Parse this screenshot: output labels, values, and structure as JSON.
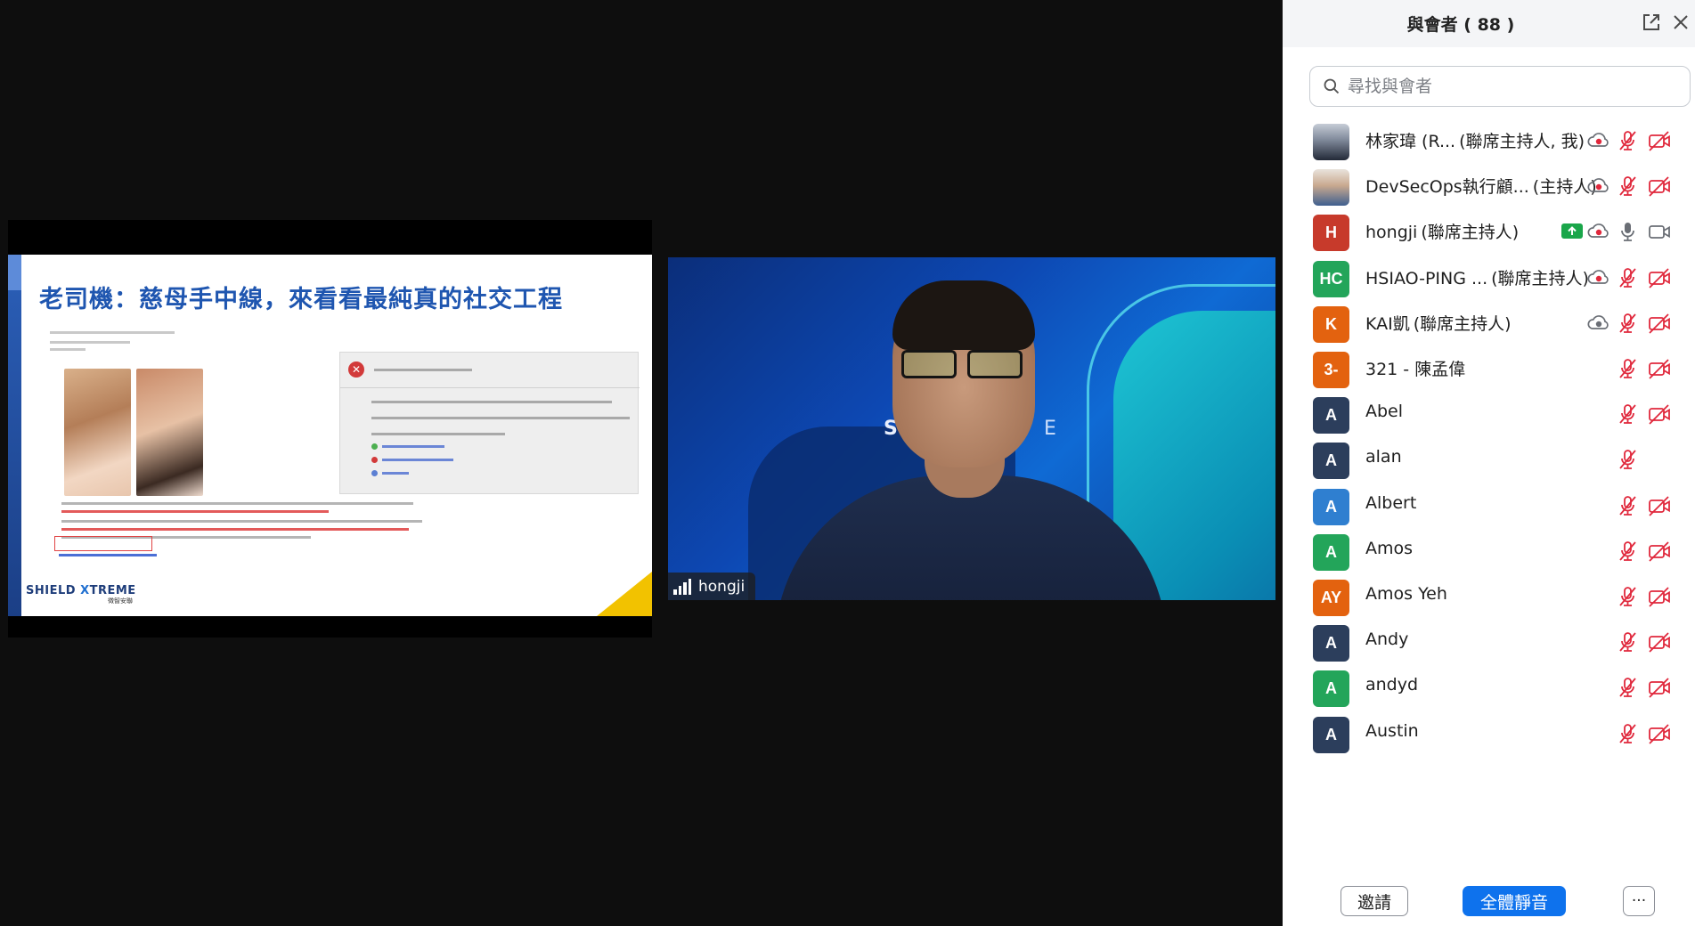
{
  "shared_screen": {
    "slide_title": "老司機：慈母手中線，來看看最純真的社交工程",
    "logo_text": "SHIELD",
    "logo_x": "X",
    "logo_suffix": "TREME",
    "logo_subtitle": "徵智安聯"
  },
  "video": {
    "participant_name": "hongji",
    "background_brand": "S",
    "background_brand_tail": "E"
  },
  "panel": {
    "title": "與會者 ( 88 )",
    "search_placeholder": "尋找與會者",
    "participants": [
      {
        "initials": "",
        "avatar_color": "#56606e",
        "name": "林家瑋 (R...",
        "role": "(聯席主持人, 我)",
        "recording": true,
        "mic": "muted",
        "video": "off"
      },
      {
        "initials": "",
        "avatar_color": "#7a8aa0",
        "name": "DevSecOps執行顧...",
        "role": "(主持人)",
        "recording": true,
        "mic": "muted",
        "video": "off"
      },
      {
        "initials": "H",
        "avatar_color": "#c73a2b",
        "name": "hongji",
        "role": "(聯席主持人)",
        "recording": true,
        "sharing": true,
        "mic": "on",
        "video": "on"
      },
      {
        "initials": "HC",
        "avatar_color": "#23a55a",
        "name": "HSIAO-PING ...",
        "role": "(聯席主持人)",
        "recording": true,
        "mic": "muted",
        "video": "off"
      },
      {
        "initials": "K",
        "avatar_color": "#e3620f",
        "name": "KAI凱",
        "role": "(聯席主持人)",
        "recording": true,
        "recording_muted": true,
        "mic": "muted",
        "video": "off"
      },
      {
        "initials": "3-",
        "avatar_color": "#e3620f",
        "name": "321 - 陳孟偉",
        "role": "",
        "mic": "muted",
        "video": "off"
      },
      {
        "initials": "A",
        "avatar_color": "#2c3e5c",
        "name": "Abel",
        "role": "",
        "mic": "muted",
        "video": "off"
      },
      {
        "initials": "A",
        "avatar_color": "#2c3e5c",
        "name": "alan",
        "role": "",
        "mic": "muted",
        "video": "none"
      },
      {
        "initials": "A",
        "avatar_color": "#2f7fd0",
        "name": "Albert",
        "role": "",
        "mic": "muted",
        "video": "off"
      },
      {
        "initials": "A",
        "avatar_color": "#23a55a",
        "name": "Amos",
        "role": "",
        "mic": "muted",
        "video": "off"
      },
      {
        "initials": "AY",
        "avatar_color": "#e3620f",
        "name": "Amos Yeh",
        "role": "",
        "mic": "muted",
        "video": "off"
      },
      {
        "initials": "A",
        "avatar_color": "#2c3e5c",
        "name": "Andy",
        "role": "",
        "mic": "muted",
        "video": "off"
      },
      {
        "initials": "A",
        "avatar_color": "#23a55a",
        "name": "andyd",
        "role": "",
        "mic": "muted",
        "video": "off"
      },
      {
        "initials": "A",
        "avatar_color": "#2c3e5c",
        "name": "Austin",
        "role": "",
        "mic": "muted",
        "video": "off"
      }
    ],
    "footer": {
      "invite_label": "邀請",
      "mute_all_label": "全體靜音",
      "more_label": "···"
    }
  },
  "colors": {
    "accent_blue": "#0e72ed",
    "muted_red": "#e0283c",
    "panel_bg": "#ffffff",
    "stage_bg": "#0e0e0e"
  }
}
